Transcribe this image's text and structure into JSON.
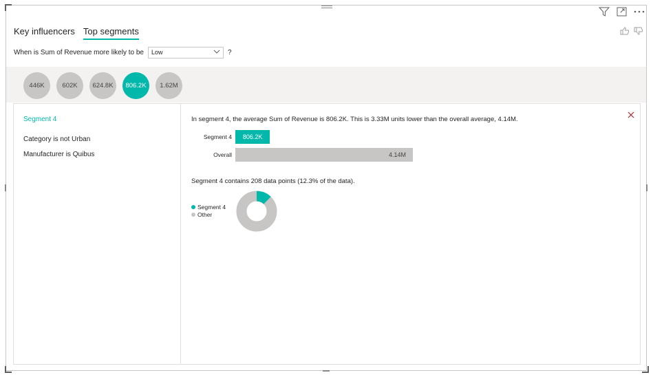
{
  "tabs": [
    {
      "label": "Key influencers",
      "active": false
    },
    {
      "label": "Top segments",
      "active": true
    }
  ],
  "question": {
    "label": "When is Sum of Revenue more likely to be",
    "selected": "Low",
    "help": "?"
  },
  "segments": [
    "446K",
    "602K",
    "624.8K",
    "806.2K",
    "1.62M"
  ],
  "active_segment_index": 3,
  "detail": {
    "title": "Segment 4",
    "conditions": [
      "Category is not Urban",
      "Manufacturer is Quibus"
    ],
    "summary": "In segment 4, the average Sum of Revenue is 806.2K. This is 3.33M units lower than the overall average, 4.14M.",
    "bars": [
      {
        "label": "Segment 4",
        "value_label": "806.2K",
        "value": 806.2
      },
      {
        "label": "Overall",
        "value_label": "4.14M",
        "value": 4140
      }
    ],
    "contains": "Segment 4 contains 208 data points (12.3% of the data).",
    "legend": [
      {
        "label": "Segment 4",
        "color": "#01b8aa"
      },
      {
        "label": "Other",
        "color": "#c8c6c4"
      }
    ],
    "share": 0.123
  },
  "icons": {
    "filter": "filter-icon",
    "focus": "focus-mode-icon",
    "more": "more-options-icon",
    "thumbs_up": "thumbs-up-icon",
    "thumbs_down": "thumbs-down-icon",
    "close": "close-icon"
  },
  "colors": {
    "accent": "#01b8aa",
    "neutral": "#c8c6c4",
    "band": "#f3f2f1"
  }
}
